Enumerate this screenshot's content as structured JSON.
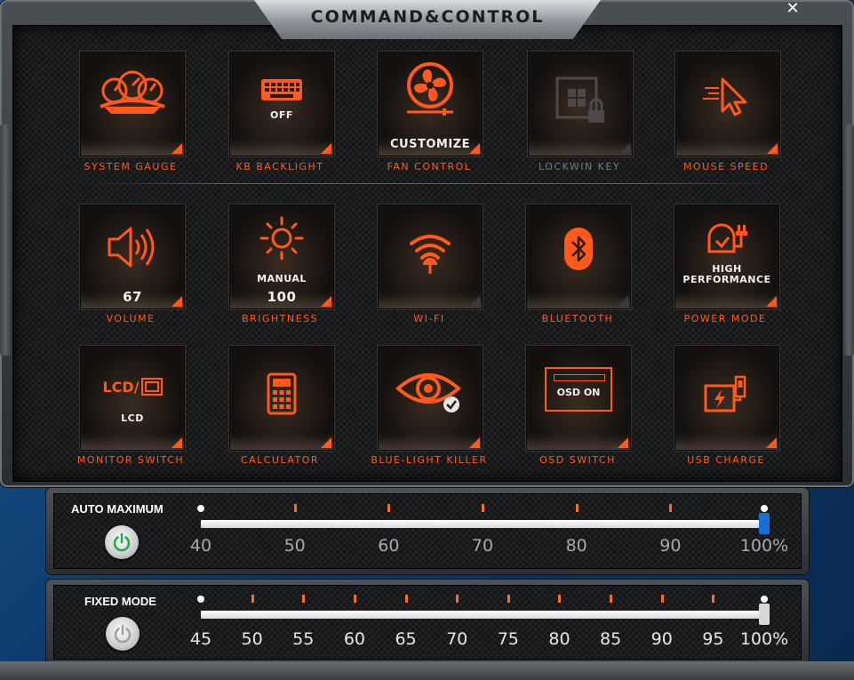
{
  "app": {
    "title": "COMMAND&CONTROL",
    "close_label": "✕"
  },
  "tiles": [
    {
      "label": "SYSTEM GAUGE",
      "icon": "gauge-icon",
      "sub": ""
    },
    {
      "label": "KB BACKLIGHT",
      "icon": "keyboard-icon",
      "sub": "OFF"
    },
    {
      "label": "FAN CONTROL",
      "icon": "fan-icon",
      "sub": "CUSTOMIZE"
    },
    {
      "label": "LOCKWIN KEY",
      "icon": "windows-lock-icon",
      "sub": ""
    },
    {
      "label": "MOUSE SPEED",
      "icon": "mouse-cursor-icon",
      "sub": ""
    },
    {
      "label": "VOLUME",
      "icon": "speaker-icon",
      "sub": "67"
    },
    {
      "label": "BRIGHTNESS",
      "icon": "sun-icon",
      "sub_top": "MANUAL",
      "sub": "100"
    },
    {
      "label": "WI-FI",
      "icon": "wifi-icon",
      "sub": ""
    },
    {
      "label": "BLUETOOTH",
      "icon": "bluetooth-icon",
      "sub": ""
    },
    {
      "label": "POWER MODE",
      "icon": "power-plug-icon",
      "sub_top": "HIGH",
      "sub": "PERFORMANCE"
    },
    {
      "label": "MONITOR SWITCH",
      "icon": "monitor-switch-icon",
      "icon_text": "LCD/",
      "sub": "LCD"
    },
    {
      "label": "CALCULATOR",
      "icon": "calculator-icon",
      "sub": ""
    },
    {
      "label": "BLUE-LIGHT KILLER",
      "icon": "eye-check-icon",
      "sub": ""
    },
    {
      "label": "OSD SWITCH",
      "icon": "osd-icon",
      "icon_text": "OSD ON",
      "sub": ""
    },
    {
      "label": "USB CHARGE",
      "icon": "usb-charge-icon",
      "sub": ""
    }
  ],
  "auto_max": {
    "title": "AUTO MAXIMUM",
    "ticks": [
      "40",
      "50",
      "60",
      "70",
      "80",
      "90",
      "100%"
    ],
    "value_percent": 100,
    "thumb_color": "#1a6fd6",
    "power_icon_color": "#2aa84a"
  },
  "fixed_mode": {
    "title": "FIXED MODE",
    "ticks": [
      "45",
      "50",
      "55",
      "60",
      "65",
      "70",
      "75",
      "80",
      "85",
      "90",
      "95",
      "100%"
    ],
    "value_percent": 100,
    "thumb_color": "#d8d8d8",
    "power_icon_color": "#a0a3a6"
  },
  "colors": {
    "accent": "#ff5a1c",
    "disabled": "#7b7b7b"
  }
}
